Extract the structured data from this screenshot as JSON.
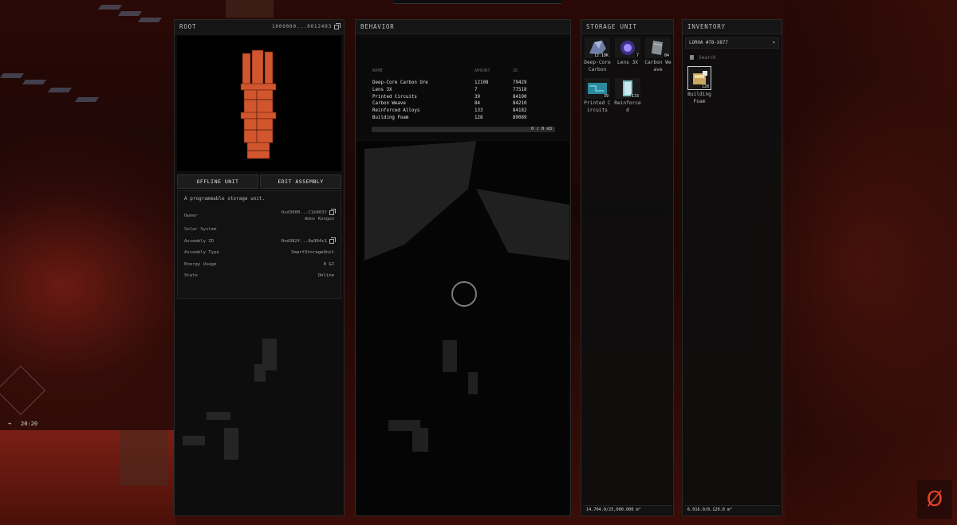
{
  "hud": {
    "time": "20:20"
  },
  "root": {
    "title": "ROOT",
    "id_short": "1000000...0012493",
    "offline_label": "OFFLINE UNIT",
    "edit_label": "EDIT ASSEMBLY",
    "description": "A programmable storage unit.",
    "rows": [
      {
        "label": "Owner",
        "value": "0xd3000...C1b803f",
        "sub": "Amos Kongun",
        "copy": true
      },
      {
        "label": "Solar System",
        "value": "",
        "copy": false
      },
      {
        "label": "Assembly ID",
        "value": "0xd382f...0a364c1",
        "copy": true
      },
      {
        "label": "Assembly Type",
        "value": "SmartStorageUnit",
        "copy": false
      },
      {
        "label": "Energy Usage",
        "value": "0 GJ",
        "copy": false
      },
      {
        "label": "State",
        "value": "Online",
        "copy": false
      }
    ]
  },
  "behavior": {
    "title": "BEHAVIOR",
    "columns": [
      "NAME",
      "AMOUNT",
      "ID"
    ],
    "rows": [
      [
        "Deep-Core Carbon Ore",
        "12108",
        "79429"
      ],
      [
        "Lens 3X",
        "7",
        "77518"
      ],
      [
        "Printed Circuits",
        "39",
        "84190"
      ],
      [
        "Carbon Weave",
        "84",
        "84210"
      ],
      [
        "Reinforced Alloys",
        "133",
        "84182"
      ],
      [
        "Building Foam",
        "128",
        "89089"
      ]
    ],
    "capacity_label": "0 / 0 m3"
  },
  "storage": {
    "title": "STORAGE UNIT",
    "items": [
      {
        "name": "Deep-Core Carbon",
        "qty": "12.1DK",
        "color": "#6f7ea8"
      },
      {
        "name": "Lens 3X",
        "qty": "7",
        "color": "#6a5bd0"
      },
      {
        "name": "Carbon Weave",
        "qty": "84",
        "color": "#8a8f96"
      },
      {
        "name": "Printed Circuits",
        "qty": "39",
        "color": "#4fc3d6"
      },
      {
        "name": "Reinforced",
        "qty": "133",
        "color": "#7fc2c9"
      }
    ],
    "capacity": "14.704.0/25,000.000 m³"
  },
  "inventory": {
    "title": "INVENTORY",
    "selected": "LORHA #78-X877",
    "search_placeholder": "Search",
    "items": [
      {
        "name": "Building Foam",
        "qty": "128",
        "color": "#c9a862"
      }
    ],
    "capacity": "6.016.0/8.120.0 m³"
  },
  "colors": {
    "accent": "#e0412c",
    "model": "#d2562d"
  }
}
